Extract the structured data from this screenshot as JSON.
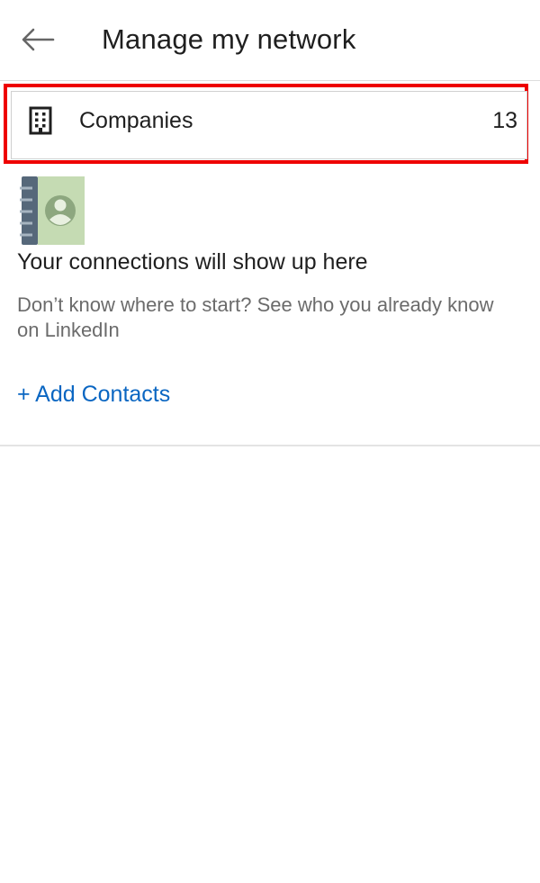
{
  "header": {
    "title": "Manage my network",
    "back_icon": "arrow-left-icon"
  },
  "companies": {
    "label": "Companies",
    "count": "13",
    "icon": "building-icon",
    "highlight_color": "#ee0000"
  },
  "empty_state": {
    "illustration": "address-book-icon",
    "heading": "Your connections will show up here",
    "description": "Don’t know where to start? See who you already know on LinkedIn",
    "add_contacts_label": "+ Add Contacts"
  },
  "colors": {
    "accent": "#0a66c2",
    "text_primary": "#1f1f1f",
    "text_secondary": "#6b6b6b"
  }
}
